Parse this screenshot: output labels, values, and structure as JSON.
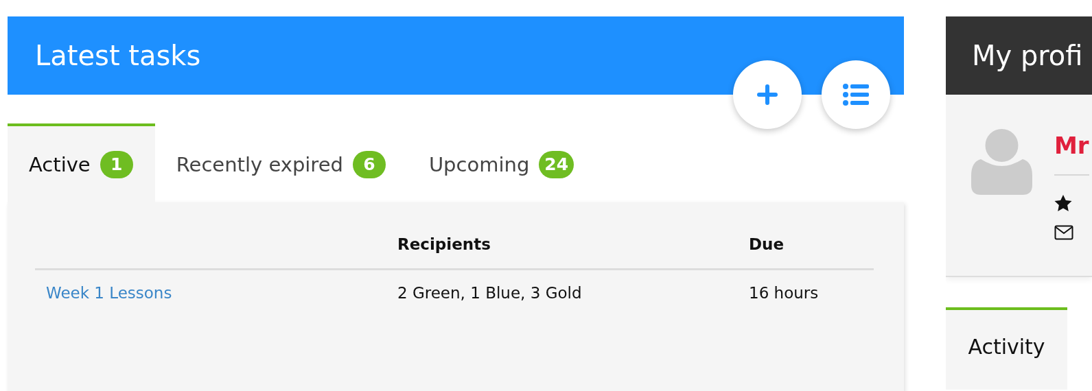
{
  "tasks_panel": {
    "title": "Latest tasks",
    "tabs": [
      {
        "label": "Active",
        "count": "1",
        "selected": true
      },
      {
        "label": "Recently expired",
        "count": "6",
        "selected": false
      },
      {
        "label": "Upcoming",
        "count": "24",
        "selected": false
      }
    ],
    "table": {
      "columns": [
        "Recipients",
        "Due"
      ],
      "rows": [
        {
          "task": "Week 1 Lessons",
          "recipients": "2 Green, 1 Blue, 3 Gold",
          "due": "16 hours"
        }
      ]
    }
  },
  "profile_panel": {
    "title": "My profi",
    "name": "Mr",
    "tabs": [
      {
        "label": "Activity",
        "selected": true
      }
    ]
  }
}
